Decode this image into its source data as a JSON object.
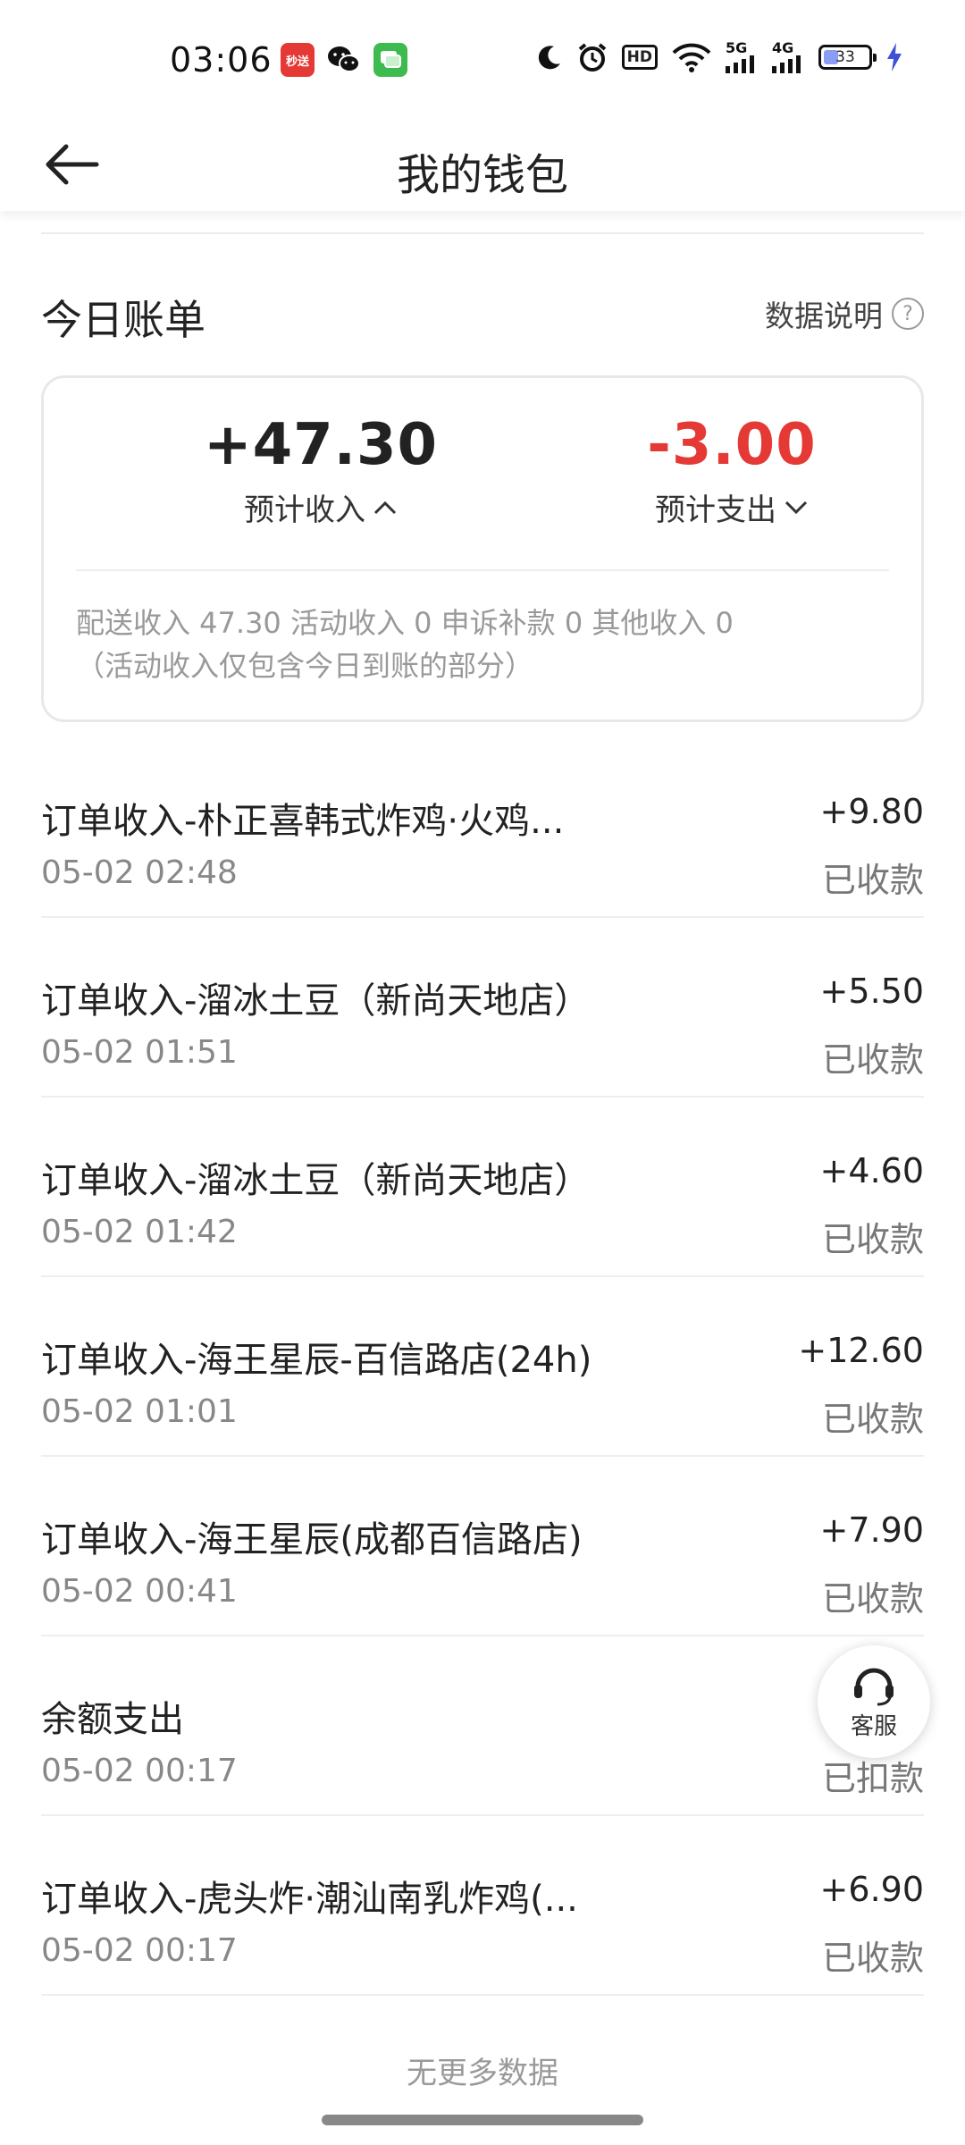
{
  "status_bar": {
    "time": "03:06",
    "app_badge_text": "秒送",
    "signal_5g": "5G",
    "signal_4g": "4G",
    "hd_label": "HD",
    "battery": "33"
  },
  "header": {
    "title": "我的钱包"
  },
  "today": {
    "title": "今日账单",
    "data_explain": "数据说明",
    "income_amount": "+47.30",
    "income_label": "预计收入",
    "expense_amount": "-3.00",
    "expense_label": "预计支出",
    "breakdown_line1": "配送收入 47.30 活动收入 0 申诉补款 0 其他收入 0",
    "breakdown_line2": "（活动收入仅包含今日到账的部分）"
  },
  "transactions": [
    {
      "title": "订单收入-朴正喜韩式炸鸡·火鸡...",
      "time": "05-02 02:48",
      "amount": "+9.80",
      "status": "已收款"
    },
    {
      "title": "订单收入-溜冰土豆（新尚天地店）",
      "time": "05-02 01:51",
      "amount": "+5.50",
      "status": "已收款"
    },
    {
      "title": "订单收入-溜冰土豆（新尚天地店）",
      "time": "05-02 01:42",
      "amount": "+4.60",
      "status": "已收款"
    },
    {
      "title": "订单收入-海王星辰-百信路店(24h)",
      "time": "05-02 01:01",
      "amount": "+12.60",
      "status": "已收款"
    },
    {
      "title": "订单收入-海王星辰(成都百信路店)",
      "time": "05-02 00:41",
      "amount": "+7.90",
      "status": "已收款"
    },
    {
      "title": "余额支出",
      "time": "05-02 00:17",
      "amount": "",
      "status": "已扣款"
    },
    {
      "title": "订单收入-虎头炸·潮汕南乳炸鸡(...",
      "time": "05-02 00:17",
      "amount": "+6.90",
      "status": "已收款"
    }
  ],
  "footer": {
    "no_more": "无更多数据"
  },
  "customer_service": {
    "label": "客服"
  },
  "colors": {
    "expense_red": "#e53935",
    "muted_text": "#999999"
  }
}
